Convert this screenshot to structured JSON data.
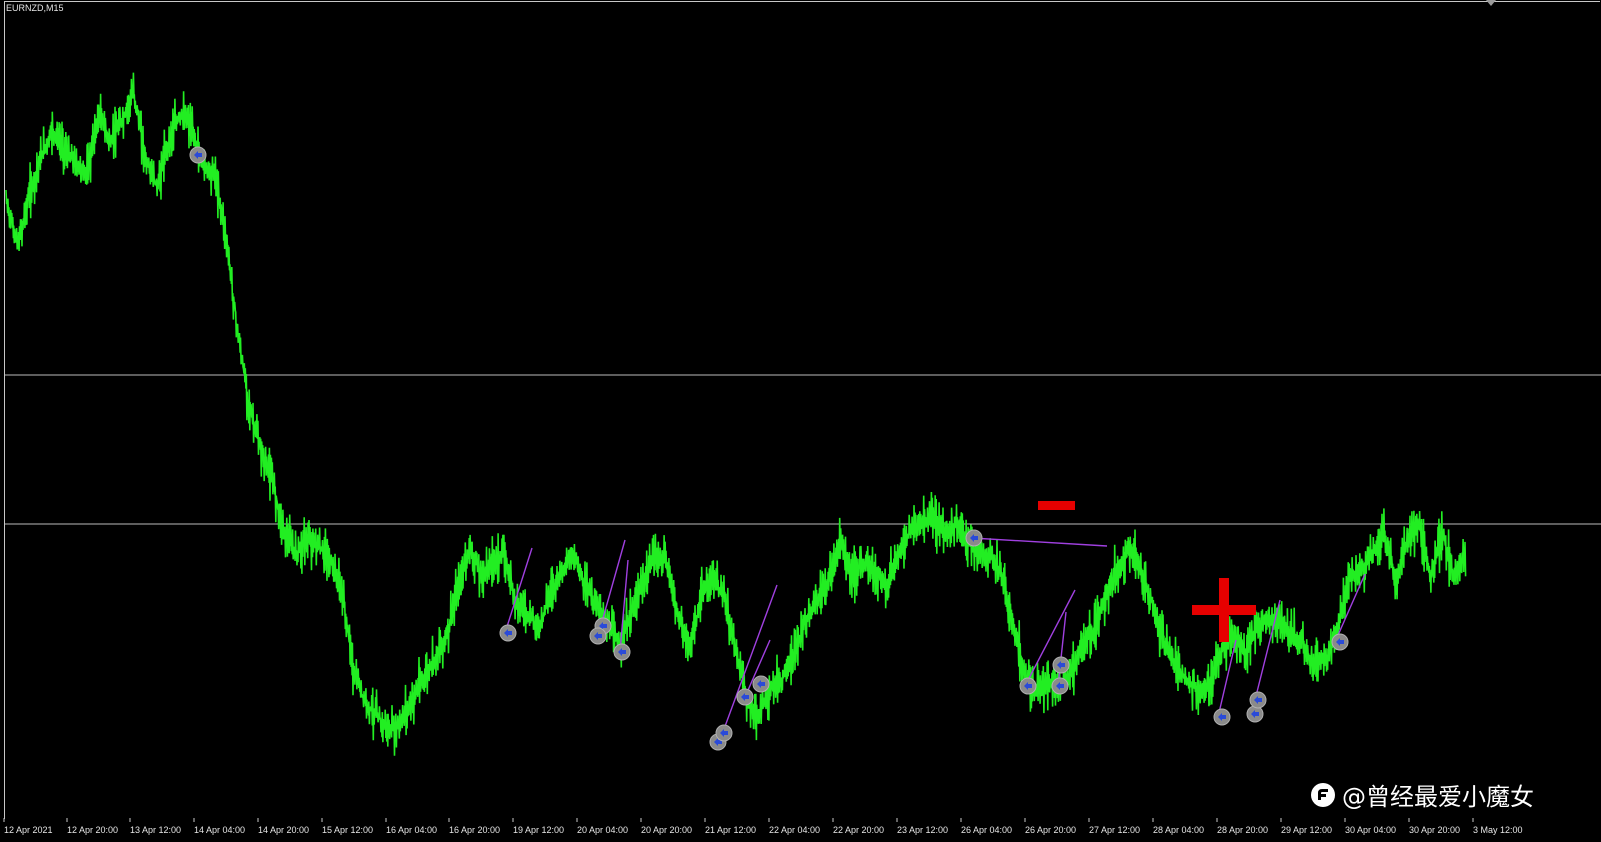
{
  "chart": {
    "symbol": "EURNZD,M15",
    "colors": {
      "background": "#000000",
      "price_line": "#22ee22",
      "hline": "#bdbdbd",
      "trade_line": "#a040e0",
      "marker_ring": "#8a8a8a",
      "marker_arrow": "#2a4ad8",
      "sign": "#e60000"
    },
    "hline_count": 2,
    "signs": {
      "minus": "-",
      "plus": "+"
    },
    "watermark": "@曾经最爱小魔女",
    "watermark_icon": "toutiao-logo-icon"
  },
  "chart_data": {
    "type": "line",
    "title": "",
    "xlabel": "",
    "ylabel": "",
    "x_ticks": [
      "12 Apr 2021",
      "12 Apr 20:00",
      "13 Apr 12:00",
      "14 Apr 04:00",
      "14 Apr 20:00",
      "15 Apr 12:00",
      "16 Apr 04:00",
      "16 Apr 20:00",
      "19 Apr 12:00",
      "20 Apr 04:00",
      "20 Apr 20:00",
      "21 Apr 12:00",
      "22 Apr 04:00",
      "22 Apr 20:00",
      "23 Apr 12:00",
      "26 Apr 04:00",
      "26 Apr 20:00",
      "27 Apr 12:00",
      "28 Apr 04:00",
      "28 Apr 20:00",
      "29 Apr 12:00",
      "30 Apr 04:00",
      "30 Apr 20:00",
      "3 May 12:00"
    ],
    "series": [
      {
        "values": [
          0.78,
          0.72,
          0.79,
          0.84,
          0.88,
          0.85,
          0.83,
          0.82,
          0.9,
          0.86,
          0.89,
          0.93,
          0.84,
          0.8,
          0.86,
          0.9,
          0.88,
          0.83,
          0.82,
          0.73,
          0.6,
          0.5,
          0.44,
          0.4,
          0.33,
          0.3,
          0.32,
          0.31,
          0.29,
          0.25,
          0.14,
          0.1,
          0.08,
          0.06,
          0.07,
          0.1,
          0.13,
          0.16,
          0.19,
          0.25,
          0.31,
          0.27,
          0.29,
          0.3,
          0.24,
          0.22,
          0.2,
          0.25,
          0.28,
          0.3,
          0.26,
          0.23,
          0.2,
          0.18,
          0.22,
          0.26,
          0.3,
          0.29,
          0.22,
          0.17,
          0.24,
          0.27,
          0.24,
          0.17,
          0.1,
          0.08,
          0.12,
          0.13,
          0.16,
          0.21,
          0.24,
          0.26,
          0.32,
          0.27,
          0.29,
          0.28,
          0.25,
          0.3,
          0.33,
          0.34,
          0.35,
          0.33,
          0.34,
          0.32,
          0.3,
          0.3,
          0.27,
          0.2,
          0.14,
          0.11,
          0.13,
          0.12,
          0.14,
          0.18,
          0.2,
          0.25,
          0.28,
          0.31,
          0.28,
          0.23,
          0.18,
          0.15,
          0.13,
          0.11,
          0.13,
          0.17,
          0.19,
          0.16,
          0.2,
          0.21,
          0.21,
          0.19,
          0.18,
          0.15,
          0.16,
          0.2,
          0.27,
          0.28,
          0.3,
          0.33,
          0.26,
          0.32,
          0.34,
          0.27,
          0.33,
          0.27,
          0.3
        ]
      }
    ],
    "horizontal_lines": 2,
    "grid": false,
    "legend": "none"
  }
}
